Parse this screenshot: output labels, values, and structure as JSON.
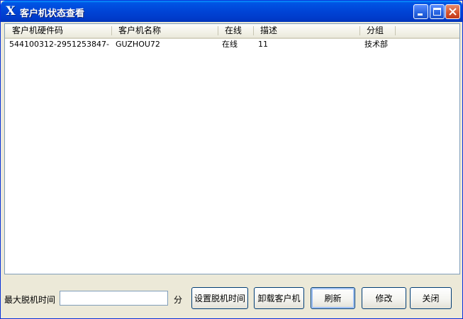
{
  "window": {
    "title": "客户机状态查看",
    "icon": "x-app-icon",
    "controls": [
      "minimize-icon",
      "maximize-icon",
      "close-icon"
    ]
  },
  "table": {
    "columns": [
      "客户机硬件码",
      "客户机名称",
      "在线",
      "描述",
      "分组"
    ],
    "rows": [
      [
        "544100312-2951253847-1...",
        "GUZHOU72",
        "在线",
        "11",
        "技术部"
      ]
    ]
  },
  "footer": {
    "offline_label": "最大脱机时间",
    "offline_value": "",
    "unit_label": "分",
    "buttons": {
      "set_offline": "设置脱机时间",
      "uninstall": "卸载客户机",
      "refresh": "刷新",
      "modify": "修改",
      "close": "关闭"
    }
  },
  "colors": {
    "titlebar": "#0055e5",
    "window_bg": "#ece9d8",
    "button_border": "#003c74"
  }
}
